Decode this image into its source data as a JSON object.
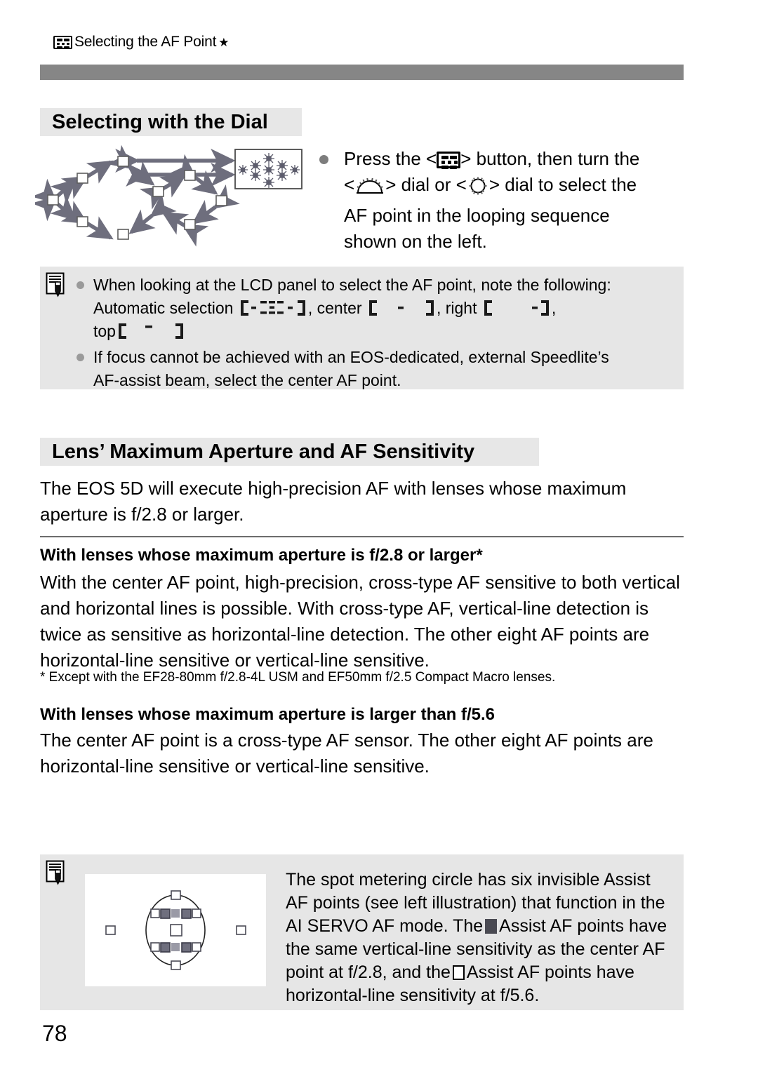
{
  "header": {
    "icon": "af-point-selection-icon",
    "title": "Selecting the AF Point",
    "star": "★"
  },
  "sections": {
    "dial": {
      "heading": "Selecting with the Dial",
      "instruction": {
        "bullet_parts": {
          "a": "Press the <",
          "b": "> button, then turn the",
          "c": "<",
          "d": "> dial or <",
          "e": "> dial to select the",
          "f": "AF point in the looping sequence",
          "g": "shown on the left."
        },
        "icons": {
          "af_button": "af-point-selection-icon",
          "main_dial": "main-dial-icon",
          "quick_control_dial": "quick-control-dial-icon"
        }
      },
      "diagram": {
        "name": "af-point-looping-sequence-diagram",
        "viewfinder_label": "viewfinder-all-af-points"
      }
    },
    "lcd_note": {
      "icon": "note-memo-icon",
      "bullet1": {
        "lead": "When looking at the LCD panel to select the AF point, note the following:",
        "line2_pre": "Automatic selection",
        "label_center": ", center",
        "label_right": ", right",
        "comma": ",",
        "label_top": "top"
      },
      "bullet2": {
        "line1": "If focus cannot be achieved with an EOS-dedicated, external Speedlite’s",
        "line2": "AF-assist beam, select the center AF point."
      }
    },
    "aperture": {
      "heading": "Lens’ Maximum Aperture and AF Sensitivity",
      "intro": "The EOS 5D will execute high-precision AF with lenses whose maximum aperture is f/2.8 or larger.",
      "f28": {
        "subheading": "With lenses whose maximum aperture is f/2.8 or larger*",
        "body": "With the center AF point, high-precision, cross-type AF sensitive to both vertical and horizontal lines is possible. With cross-type AF, vertical-line detection is twice as sensitive as horizontal-line detection. The other eight AF points are horizontal-line sensitive or vertical-line sensitive.",
        "footnote": "* Except with the EF28-80mm f/2.8-4L USM and EF50mm f/2.5 Compact Macro lenses."
      },
      "f56": {
        "subheading": "With lenses whose maximum aperture is larger than f/5.6",
        "body": "The center AF point is a cross-type AF sensor. The other eight AF points are horizontal-line sensitive or vertical-line sensitive."
      }
    },
    "spot_note": {
      "icon": "note-memo-icon",
      "illustration": "spot-metering-circle-diagram",
      "text_parts": {
        "p1": "The spot metering circle has six invisible Assist AF points (see left illustration) that function in the AI SERVO AF mode. The",
        "p2": "Assist AF points have the same vertical-line sensitivity as the center AF point at f/2.8, and the",
        "p3": "Assist AF points have horizontal-line sensitivity at f/5.6."
      },
      "glyphs": {
        "filled": "filled-square-glyph",
        "open": "open-square-glyph"
      }
    }
  },
  "page_number": "78",
  "colors": {
    "header_bar": "#868686",
    "section_heading_bg": "#e7e7e7",
    "note_box_bg": "#e6e6e6",
    "arrow_gray": "#6e6e7d",
    "bullet_gray": "#7d7d7d"
  }
}
